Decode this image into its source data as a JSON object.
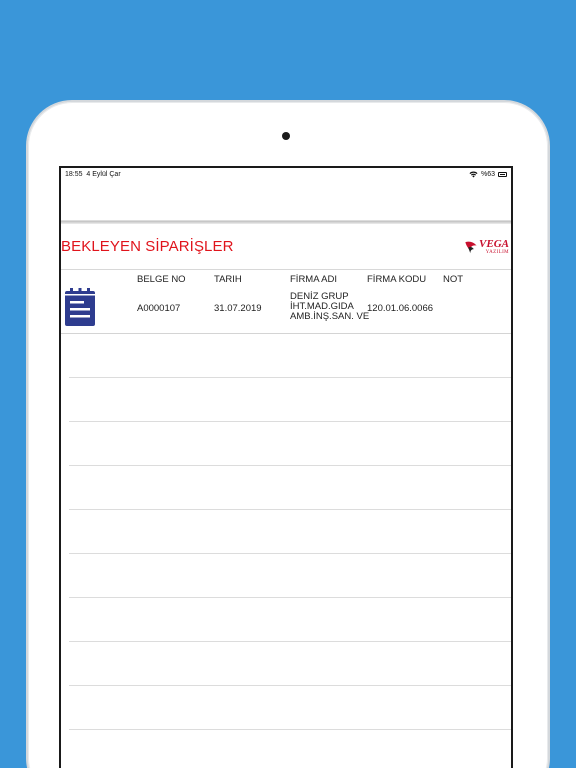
{
  "statusbar": {
    "time": "18:55",
    "date": "4 Eylül Çar",
    "battery": "%63"
  },
  "header": {
    "title": "BEKLEYEN SİPARİŞLER"
  },
  "logo": {
    "main": "VEGA",
    "sub": "YAZILIM",
    "color": "#c8102e"
  },
  "table": {
    "columns": [
      "BELGE NO",
      "TARIH",
      "FİRMA ADI",
      "FİRMA KODU",
      "NOT"
    ],
    "rows": [
      {
        "belge_no": "A0000107",
        "tarih": "31.07.2019",
        "firma_adi": [
          "DENİZ GRUP",
          "İHT.MAD.GIDA",
          "AMB.İNŞ.SAN. VE"
        ],
        "firma_kodu": "120.01.06.0066",
        "not": ""
      }
    ]
  },
  "colors": {
    "background": "#3a96d9",
    "title": "#e0141c",
    "icon": "#2e3c8f"
  }
}
